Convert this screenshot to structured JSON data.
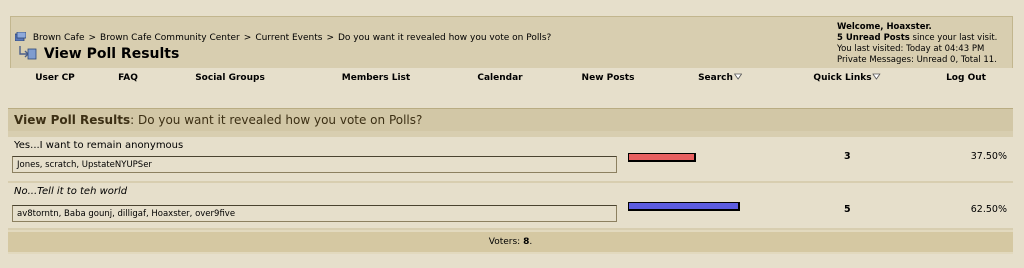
{
  "breadcrumb": {
    "items": [
      "Brown Cafe",
      "Brown Cafe Community Center",
      "Current Events",
      "Do you want it revealed how you vote on Polls?"
    ],
    "separator": ">"
  },
  "page_title": "View Poll Results",
  "welcome": {
    "greeting": "Welcome, Hoaxster.",
    "unread_posts": "5 Unread Posts",
    "unread_suffix": " since your last visit.",
    "last_visited": "You last visited: Today at 04:43 PM",
    "private_messages": "Private Messages: Unread 0, Total 11."
  },
  "nav": {
    "user_cp": "User CP",
    "faq": "FAQ",
    "social_groups": "Social Groups",
    "members_list": "Members List",
    "calendar": "Calendar",
    "new_posts": "New Posts",
    "search": "Search",
    "quick_links": "Quick Links",
    "log_out": "Log Out"
  },
  "poll": {
    "heading_label": "View Poll Results",
    "heading_question": ": Do you want it revealed how you vote on Polls?",
    "options": [
      {
        "label": "Yes...I want to remain anonymous",
        "voters": "Jones, scratch, UpstateNYUPSer",
        "count": "3",
        "percent": "37.50%",
        "fraction": 0.375,
        "bar_color": "#e86060"
      },
      {
        "label": "No...Tell it to teh world",
        "voters": "av8torntn, Baba gounj, dilligaf, Hoaxster, over9five",
        "count": "5",
        "percent": "62.50%",
        "fraction": 0.625,
        "bar_color": "#5c5ce0"
      }
    ],
    "voters_label": "Voters: ",
    "voters_total": "8",
    "voters_end": "."
  },
  "colors": {
    "page_bg": "#e6dfcb",
    "header_bg": "#d8ceb0",
    "accent_text": "#3c2f14"
  },
  "icons": {
    "home": "forum-home-icon",
    "return": "return-arrow-icon",
    "dropdown": "chevron-down-icon"
  }
}
